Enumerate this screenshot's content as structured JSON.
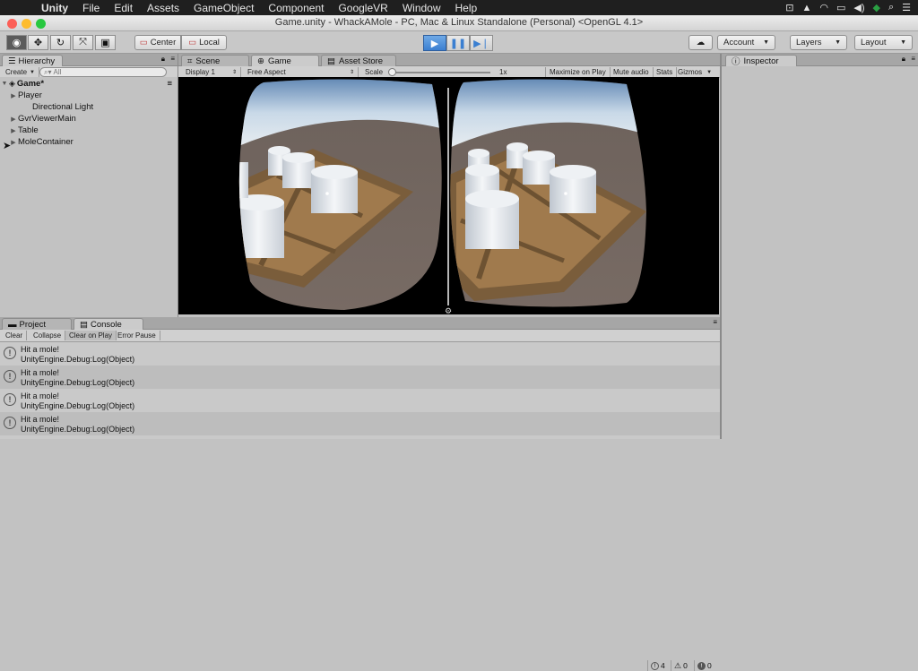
{
  "menubar": {
    "app": "Unity",
    "items": [
      "File",
      "Edit",
      "Assets",
      "GameObject",
      "Component",
      "GoogleVR",
      "Window",
      "Help"
    ]
  },
  "window": {
    "title": "Game.unity - WhackAMole - PC, Mac & Linux Standalone (Personal) <OpenGL 4.1>"
  },
  "toolbar": {
    "center_label": "Center",
    "local_label": "Local",
    "account_label": "Account",
    "layers_label": "Layers",
    "layout_label": "Layout"
  },
  "hierarchy": {
    "tab_label": "Hierarchy",
    "create_label": "Create",
    "search_placeholder": "All",
    "scene_name": "Game*",
    "items": [
      {
        "label": "Player",
        "has_children": true
      },
      {
        "label": "Directional Light",
        "has_children": false
      },
      {
        "label": "GvrViewerMain",
        "has_children": true
      },
      {
        "label": "Table",
        "has_children": true
      },
      {
        "label": "MoleContainer",
        "has_children": true
      }
    ]
  },
  "center_tabs": {
    "scene": "Scene",
    "game": "Game",
    "asset_store": "Asset Store"
  },
  "game_toolbar": {
    "display": "Display 1",
    "aspect": "Free Aspect",
    "scale_label": "Scale",
    "scale_value": "1x",
    "maximize": "Maximize on Play",
    "mute": "Mute audio",
    "stats": "Stats",
    "gizmos": "Gizmos"
  },
  "inspector": {
    "tab_label": "Inspector"
  },
  "bottom_tabs": {
    "project": "Project",
    "console": "Console"
  },
  "console": {
    "clear": "Clear",
    "collapse": "Collapse",
    "clear_on_play": "Clear on Play",
    "error_pause": "Error Pause",
    "count_logs": "4",
    "count_warnings": "0",
    "count_errors": "0",
    "entries": [
      {
        "message": "Hit a mole!",
        "trace": "UnityEngine.Debug:Log(Object)"
      },
      {
        "message": "Hit a mole!",
        "trace": "UnityEngine.Debug:Log(Object)"
      },
      {
        "message": "Hit a mole!",
        "trace": "UnityEngine.Debug:Log(Object)"
      },
      {
        "message": "Hit a mole!",
        "trace": "UnityEngine.Debug:Log(Object)"
      }
    ]
  },
  "colors": {
    "play_accent": "#3b7fd1",
    "menubar": "#1f1f1f",
    "panel": "#c2c2c2"
  }
}
